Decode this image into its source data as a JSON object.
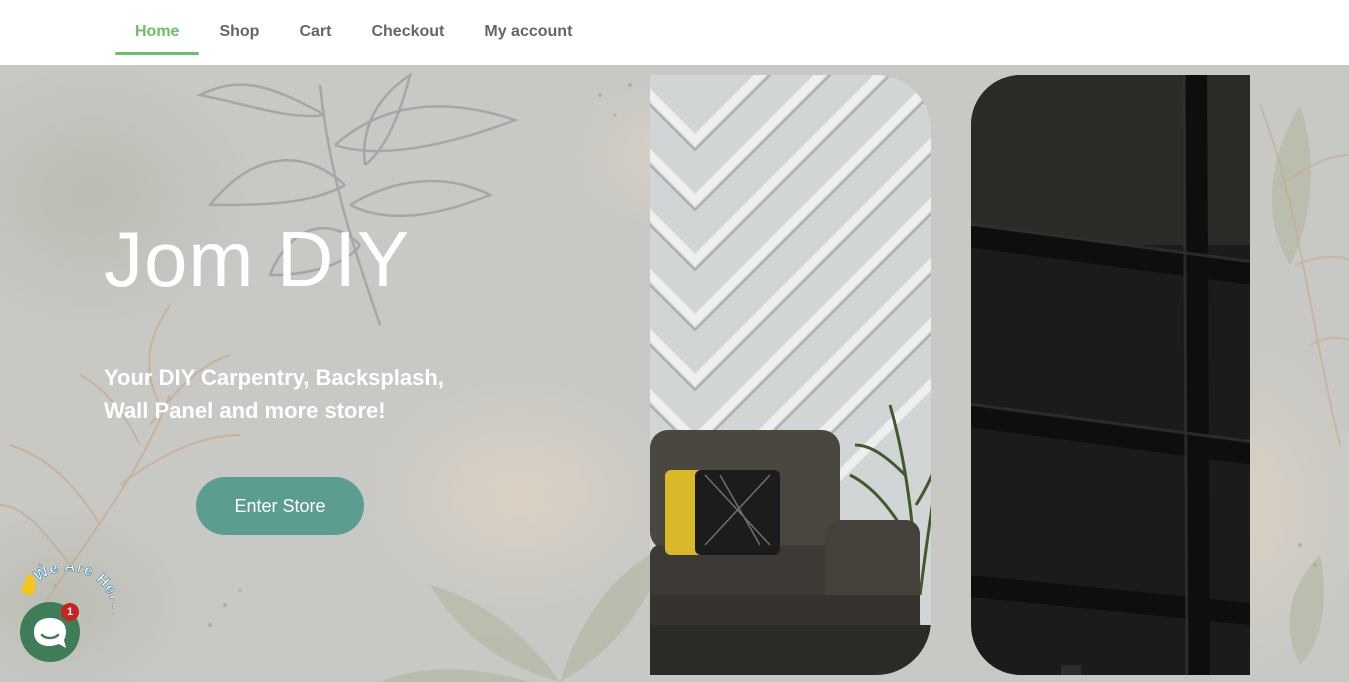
{
  "nav": {
    "items": [
      {
        "label": "Home",
        "active": true
      },
      {
        "label": "Shop",
        "active": false
      },
      {
        "label": "Cart",
        "active": false
      },
      {
        "label": "Checkout",
        "active": false
      },
      {
        "label": "My account",
        "active": false
      }
    ]
  },
  "hero": {
    "title": "Jom DIY",
    "subtitle": "Your DIY Carpentry, Backsplash, Wall Panel and more store!",
    "cta_label": "Enter Store"
  },
  "chat": {
    "tagline": "We Are Here!",
    "badge_count": "1",
    "icon": "chat-bubble-icon"
  },
  "colors": {
    "accent": "#6abf69",
    "cta": "#5c9d92",
    "chat": "#3e7d57",
    "badge": "#c9231f"
  }
}
